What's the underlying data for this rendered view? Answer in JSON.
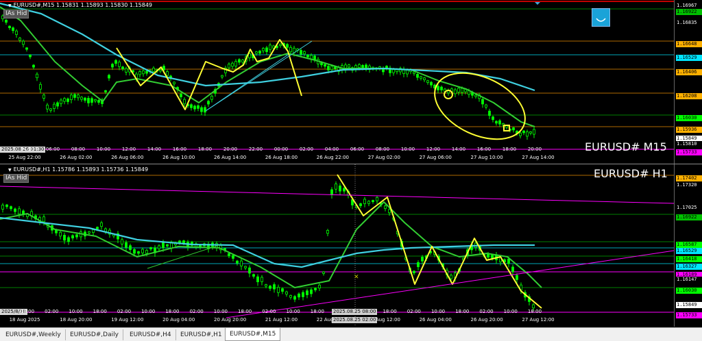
{
  "pane1": {
    "info_line": "EURUSD#,M15  1.15831 1.15893 1.15830 1.15849",
    "hide_button": "IAs Hid",
    "symbol_label": "EURUSD# M15",
    "price_labels": [
      {
        "price": "1.16967",
        "bg": "#000000",
        "fg": "#ffffff"
      },
      {
        "price": "1.16922",
        "bg": "#00c000",
        "fg": "#000000"
      },
      {
        "price": "1.16835",
        "bg": "#000000",
        "fg": "#ffffff"
      },
      {
        "price": "1.16648",
        "bg": "#ffb000",
        "fg": "#000000"
      },
      {
        "price": "1.16529",
        "bg": "#00e5ff",
        "fg": "#000000"
      },
      {
        "price": "1.16406",
        "bg": "#ffb000",
        "fg": "#000000"
      },
      {
        "price": "1.16208",
        "bg": "#ffb000",
        "fg": "#000000"
      },
      {
        "price": "1.16030",
        "bg": "#00ff00",
        "fg": "#000000"
      },
      {
        "price": "1.15936",
        "bg": "#ffb000",
        "fg": "#000000"
      },
      {
        "price": "1.15849",
        "bg": "#ffffff",
        "fg": "#000000"
      },
      {
        "price": "1.15810",
        "bg": "#000000",
        "fg": "#ffffff"
      },
      {
        "price": "1.15733",
        "bg": "#ff00ff",
        "fg": "#000000"
      }
    ],
    "time_start_box": "2025.08.26 01:30",
    "time_labels": [
      "04:00",
      "06:00",
      "08:00",
      "10:00",
      "12:00",
      "14:00",
      "16:00",
      "18:00",
      "20:00",
      "22:00",
      "00:00",
      "02:00",
      "04:00",
      "06:00",
      "08:00",
      "10:00",
      "12:00",
      "14:00",
      "16:00",
      "18:00",
      "20:00"
    ],
    "date_labels": [
      "25 Aug 22:00",
      "26 Aug 02:00",
      "26 Aug 06:00",
      "26 Aug 10:00",
      "26 Aug 14:00",
      "26 Aug 18:00",
      "26 Aug 22:00",
      "27 Aug 02:00",
      "27 Aug 06:00",
      "27 Aug 10:00",
      "27 Aug 14:00"
    ]
  },
  "pane2": {
    "info_line": "EURUSD#,H1  1.15786 1.15893 1.15736 1.15849",
    "hide_button": "IAs Hid",
    "symbol_label": "EURUSD# H1",
    "price_labels": [
      {
        "price": "1.17402",
        "bg": "#ffb000",
        "fg": "#000000"
      },
      {
        "price": "1.17320",
        "bg": "#000000",
        "fg": "#ffffff"
      },
      {
        "price": "1.17025",
        "bg": "#000000",
        "fg": "#ffffff"
      },
      {
        "price": "1.16922",
        "bg": "#00c000",
        "fg": "#000000"
      },
      {
        "price": "1.16587",
        "bg": "#00ff00",
        "fg": "#000000"
      },
      {
        "price": "1.16529",
        "bg": "#00e5ff",
        "fg": "#000000"
      },
      {
        "price": "1.16418",
        "bg": "#00ff00",
        "fg": "#000000"
      },
      {
        "price": "1.16327",
        "bg": "#00e5ff",
        "fg": "#000000"
      },
      {
        "price": "1.16189",
        "bg": "#ff00ff",
        "fg": "#000000"
      },
      {
        "price": "1.16147",
        "bg": "#000000",
        "fg": "#ffffff"
      },
      {
        "price": "1.16030",
        "bg": "#00ff00",
        "fg": "#000000"
      },
      {
        "price": "1.15849",
        "bg": "#ffffff",
        "fg": "#000000"
      },
      {
        "price": "1.15733",
        "bg": "#ff00ff",
        "fg": "#000000"
      }
    ],
    "time_start_box": "2025/8/18",
    "time_labels": [
      "18:00",
      "02:00",
      "10:00",
      "18:00",
      "02:00",
      "10:00",
      "18:00",
      "02:00",
      "10:00",
      "18:00",
      "02:00",
      "10:00",
      "18:00",
      "02:00",
      "10:00",
      "18:00",
      "02:00",
      "10:00",
      "18:00",
      "02:00",
      "10:00",
      "18:00"
    ],
    "date_labels": [
      "18 Aug 2025",
      "18 Aug 20:00",
      "19 Aug 12:00",
      "20 Aug 04:00",
      "20 Aug 20:00",
      "21 Aug 12:00",
      "22 Aug 04:00",
      "25 Aug 12:00",
      "26 Aug 04:00",
      "26 Aug 20:00",
      "27 Aug 12:00"
    ],
    "crosshair_time_top": "2025.08.25 08:00",
    "crosshair_time_bottom": "2025.08.25 02:00"
  },
  "tabs": [
    "EURUSD#,Weekly",
    "EURUSD#,Daily",
    "EURUSD#,H4",
    "EURUSD#,H1",
    "EURUSD#,M15"
  ],
  "active_tab": "EURUSD#,M15",
  "colors": {
    "candle": "#00ff00",
    "ma_fast": "#32cd32",
    "ma_slow": "#3fd0e0",
    "zigzag": "#ffff33",
    "trendline_h1": "#ff00ff",
    "trendline_m15": "#3fd0e0",
    "level_orange": "#b06a00",
    "level_cyan": "#00a8b8",
    "level_green": "#008000",
    "level_red": "#ff0000"
  },
  "icons": {
    "top_right": "smiley-icon"
  }
}
